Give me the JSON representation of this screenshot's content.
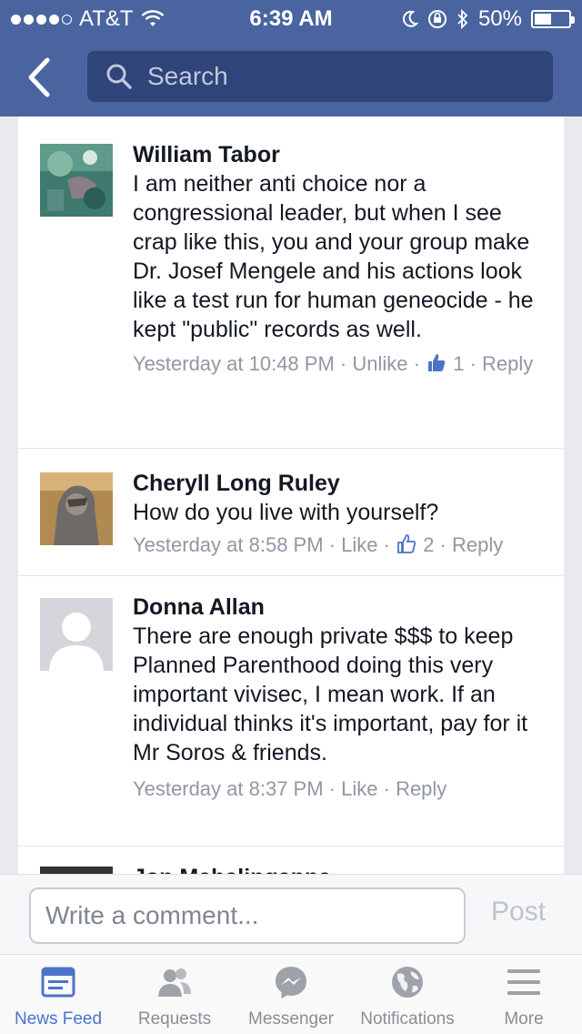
{
  "status_bar": {
    "carrier": "AT&T",
    "time": "6:39 AM",
    "battery": "50%",
    "battery_level": 0.5
  },
  "header": {
    "search_placeholder": "Search",
    "back_icon": "chevron-left-icon",
    "search_icon": "magnifier-icon"
  },
  "comments": [
    {
      "name": "William Tabor",
      "text": "I am neither anti choice nor a congressional leader, but when I see crap like this,  you and your group make Dr. Josef Mengele and his actions look like a test run for human geneocide - he kept \"public\" records as well.",
      "time": "Yesterday at 10:48 PM",
      "action": "Unlike",
      "likes": "1",
      "reply": "Reply",
      "liked": true
    },
    {
      "name": "Cheryll Long Ruley",
      "text": "How do you live with yourself?",
      "time": "Yesterday at 8:58 PM",
      "action": "Like",
      "likes": "2",
      "reply": "Reply",
      "liked": false
    },
    {
      "name": "Donna Allan",
      "text": "There are enough private $$$ to keep Planned Parenthood doing this very important vivisec, I mean work. If an individual thinks it's important, pay for it Mr Soros & friends.",
      "time": "Yesterday at 8:37 PM",
      "action": "Like",
      "reply": "Reply"
    },
    {
      "name": "Jon Mahalingappa"
    }
  ],
  "compose": {
    "placeholder": "Write a comment...",
    "post_label": "Post"
  },
  "tabs": [
    {
      "label": "News Feed",
      "icon": "news-feed-icon",
      "active": true
    },
    {
      "label": "Requests",
      "icon": "friend-requests-icon"
    },
    {
      "label": "Messenger",
      "icon": "messenger-icon"
    },
    {
      "label": "Notifications",
      "icon": "globe-icon"
    },
    {
      "label": "More",
      "icon": "menu-icon"
    }
  ],
  "colors": {
    "header": "#4a64a0",
    "search_box": "#2f4478",
    "link_blue": "#4c73c8",
    "meta_gray": "#9197a3"
  }
}
